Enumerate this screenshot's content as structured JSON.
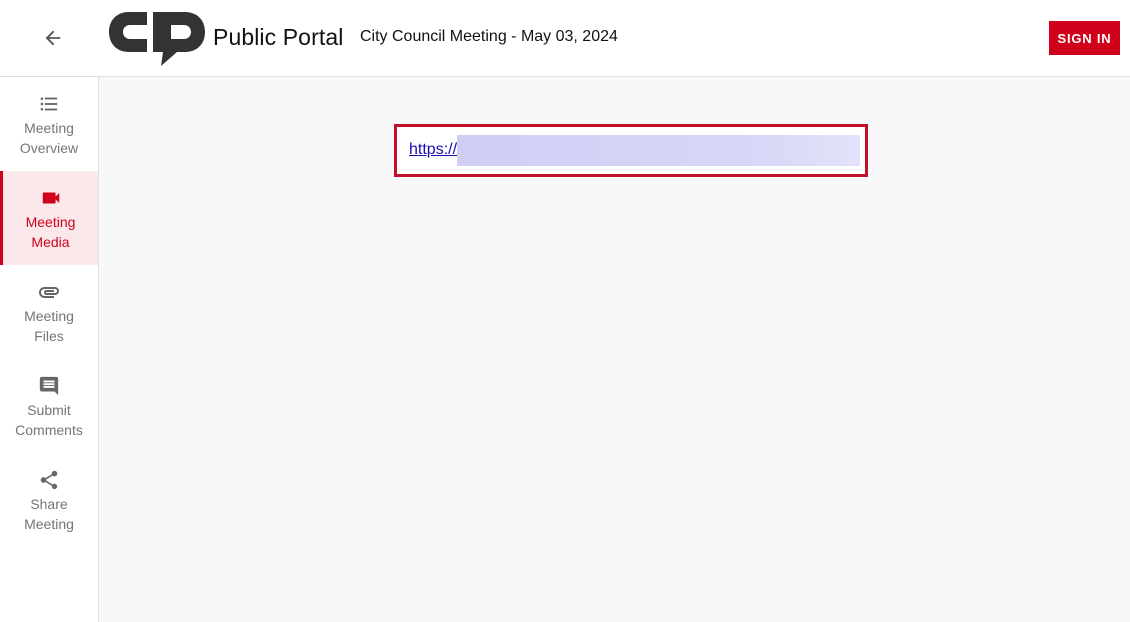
{
  "header": {
    "back_icon": "arrow-left-icon",
    "logo_icon": "cp-logo",
    "portal_name": "Public Portal",
    "meeting_title": "City Council Meeting - May 03, 2024",
    "signin_label": "SIGN IN"
  },
  "sidebar": {
    "items": [
      {
        "line1": "Meeting",
        "line2": "Overview",
        "icon": "list-icon",
        "active": false
      },
      {
        "line1": "Meeting",
        "line2": "Media",
        "icon": "video-camera-icon",
        "active": true
      },
      {
        "line1": "Meeting",
        "line2": "Files",
        "icon": "paperclip-icon",
        "active": false
      },
      {
        "line1": "Submit",
        "line2": "Comments",
        "icon": "comment-icon",
        "active": false
      },
      {
        "line1": "Share",
        "line2": "Meeting",
        "icon": "share-icon",
        "active": false
      }
    ]
  },
  "main": {
    "media_link_text": "https://"
  },
  "colors": {
    "accent": "#d0021b",
    "active_bg": "#fbe8eb",
    "link": "#1a0dab"
  }
}
